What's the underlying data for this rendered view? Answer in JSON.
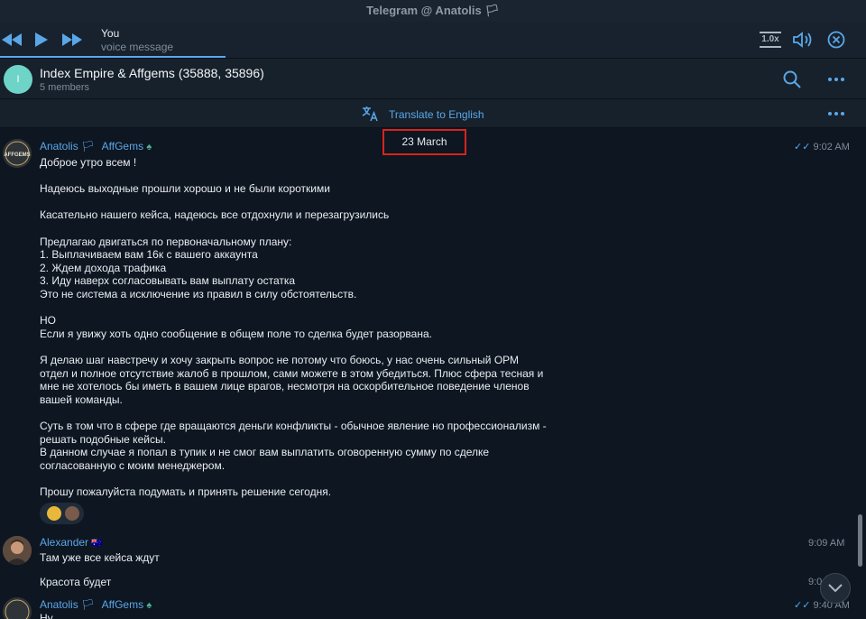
{
  "window": {
    "title": "Telegram @ Anatolis 🏳"
  },
  "player": {
    "rewind_icon": "rewind-icon",
    "play_icon": "play-icon",
    "forward_icon": "fast-forward-icon",
    "author": "You",
    "kind": "voice message",
    "speed": "1.0x",
    "volume_icon": "volume-icon",
    "close_icon": "close-icon"
  },
  "chat": {
    "avatar_letter": "I",
    "name": "Index Empire & Affgems (35888, 35896)",
    "members": "5 members",
    "search_icon": "search-icon",
    "more_icon": "more-icon",
    "accent": "#5aa7e8"
  },
  "translate": {
    "label": "Translate to English",
    "icon": "translate-icon",
    "more_icon": "more-icon"
  },
  "date_separator": "23 March",
  "messages": [
    {
      "sender": "Anatolis 🏳",
      "sender_tag": "AffGems",
      "sender_tag_icon": "leaf-icon",
      "time": "9:02 AM",
      "read": true,
      "lines": [
        "Доброе утро всем !",
        "",
        "Надеюсь выходные прошли хорошо и не были короткими",
        "",
        "Касательно нашего кейса, надеюсь все отдохнули и перезагрузились",
        "",
        "Предлагаю двигаться по первоначальному плану:",
        "1. Выплачиваем вам 16к с вашего аккаунта",
        "2. Ждем дохода трафика",
        "3. Иду наверх согласовывать вам выплату остатка",
        "Это не система а исключение из правил в силу обстоятельств.",
        "",
        "НО",
        "Если я увижу хоть одно сообщение в общем поле то сделка будет разорвана.",
        "",
        "Я делаю шаг навстречу и хочу закрыть вопрос не потому что боюсь, у нас очень сильный ОРМ",
        "отдел и полное отсутствие жалоб в прошлом, сами можете в этом убедиться. Плюс сфера тесная и",
        "мне не хотелось бы иметь в вашем лице врагов, несмотря на оскорбительное поведение членов",
        "вашей команды.",
        "",
        "Суть в том что в сфере где вращаются деньги конфликты - обычное явление но профессионализм -",
        "решать подобные кейсы.",
        "В данном случае я попал в тупик и не смог вам выплатить оговоренную сумму по сделке",
        "согласованную с моим менеджером.",
        "",
        "Прошу пожалуйста подумать и принять решение сегодня."
      ]
    },
    {
      "sender": "Alexander",
      "time": "9:09 AM",
      "lines": [
        "Там уже все кейса ждут"
      ]
    },
    {
      "lines": [
        "Красота будет"
      ],
      "time": "9:0"
    },
    {
      "sender": "Anatolis 🏳",
      "sender_tag": "AffGems",
      "sender_tag_icon": "leaf-icon",
      "time": "9:40 AM",
      "read": true,
      "lines": [
        "Ну"
      ]
    }
  ]
}
